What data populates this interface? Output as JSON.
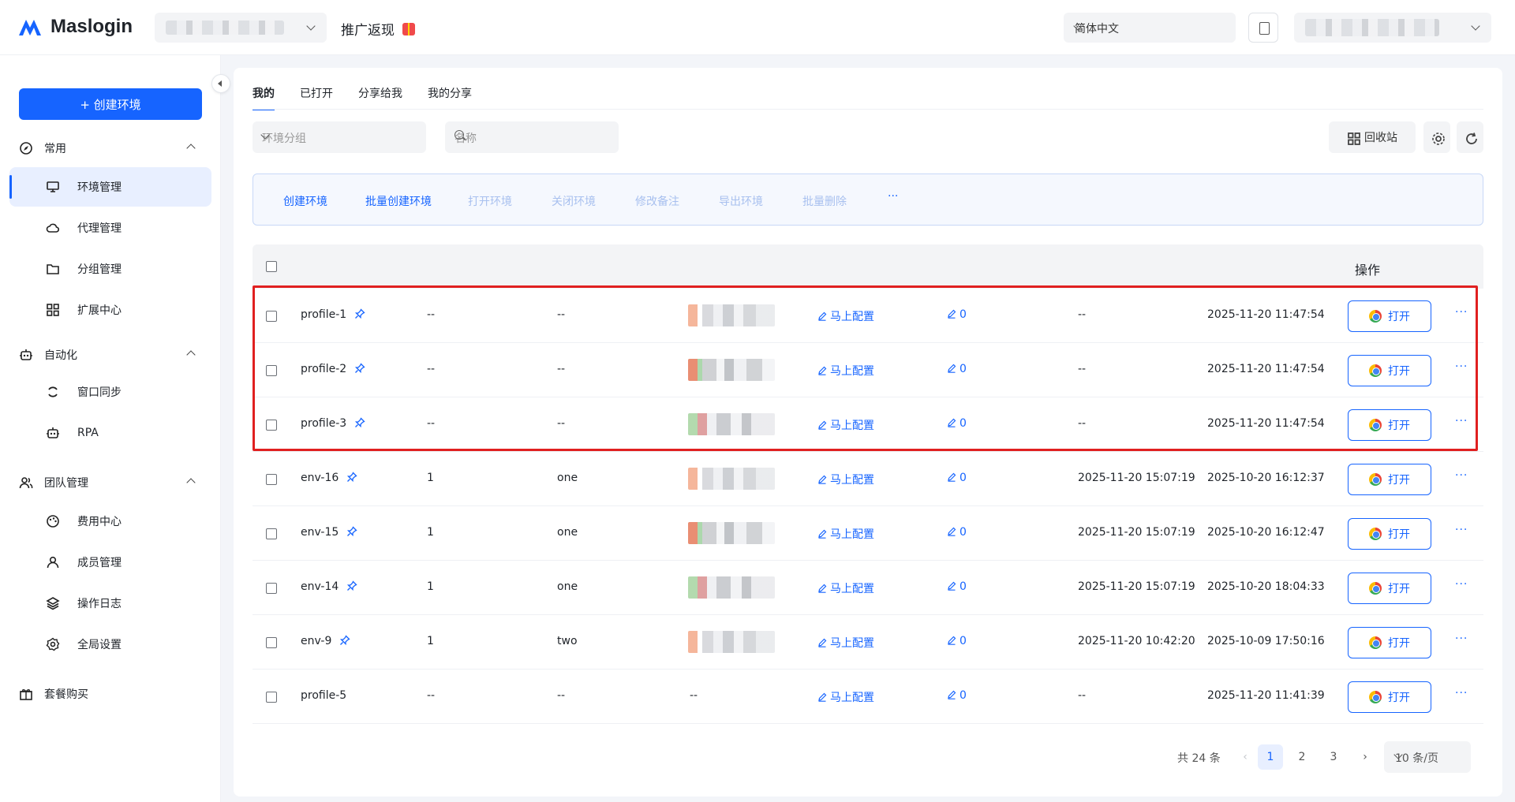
{
  "header": {
    "logo_text": "Maslogin",
    "promo_label": "推广返现",
    "language": "简体中文"
  },
  "sidebar": {
    "create_label": "+ 创建环境",
    "groups": [
      {
        "label": "常用",
        "items": [
          "环境管理",
          "代理管理",
          "分组管理",
          "扩展中心"
        ]
      },
      {
        "label": "自动化",
        "items": [
          "窗口同步",
          "RPA"
        ]
      },
      {
        "label": "团队管理",
        "items": [
          "费用中心",
          "成员管理",
          "操作日志",
          "全局设置"
        ]
      }
    ],
    "bottom_item": "套餐购买"
  },
  "main": {
    "tabs": [
      "我的",
      "已打开",
      "分享给我",
      "我的分享"
    ],
    "filters": {
      "group_placeholder": "环境分组",
      "name_placeholder": "名称"
    },
    "recycle_label": "回收站",
    "actions": [
      "创建环境",
      "批量创建环境",
      "打开环境",
      "关闭环境",
      "修改备注",
      "导出环境",
      "批量删除",
      "···"
    ],
    "table": {
      "header_action": "操作",
      "config_label": "马上配置",
      "open_label": "打开",
      "more_label": "···",
      "rows": [
        {
          "name": "profile-1",
          "pinned": true,
          "col2": "--",
          "col3": "--",
          "has_proxy_img": true,
          "count": "0",
          "opened": "--",
          "created": "2025-11-20 11:47:54"
        },
        {
          "name": "profile-2",
          "pinned": true,
          "col2": "--",
          "col3": "--",
          "has_proxy_img": true,
          "count": "0",
          "opened": "--",
          "created": "2025-11-20 11:47:54"
        },
        {
          "name": "profile-3",
          "pinned": true,
          "col2": "--",
          "col3": "--",
          "has_proxy_img": true,
          "count": "0",
          "opened": "--",
          "created": "2025-11-20 11:47:54"
        },
        {
          "name": "env-16",
          "pinned": true,
          "col2": "1",
          "col3": "one",
          "has_proxy_img": true,
          "count": "0",
          "opened": "2025-11-20 15:07:19",
          "created": "2025-10-20 16:12:37"
        },
        {
          "name": "env-15",
          "pinned": true,
          "col2": "1",
          "col3": "one",
          "has_proxy_img": true,
          "count": "0",
          "opened": "2025-11-20 15:07:19",
          "created": "2025-10-20 16:12:47"
        },
        {
          "name": "env-14",
          "pinned": true,
          "col2": "1",
          "col3": "one",
          "has_proxy_img": true,
          "count": "0",
          "opened": "2025-11-20 15:07:19",
          "created": "2025-10-20 18:04:33"
        },
        {
          "name": "env-9",
          "pinned": true,
          "col2": "1",
          "col3": "two",
          "has_proxy_img": true,
          "count": "0",
          "opened": "2025-11-20 10:42:20",
          "created": "2025-10-09 17:50:16"
        },
        {
          "name": "profile-5",
          "pinned": false,
          "col2": "--",
          "col3": "--",
          "has_proxy_img": false,
          "proxy_text": "--",
          "count": "0",
          "opened": "--",
          "created": "2025-11-20 11:41:39"
        }
      ]
    },
    "pagination": {
      "total": "共 24 条",
      "pages": [
        "1",
        "2",
        "3"
      ],
      "current": "1",
      "page_size": "10 条/页"
    }
  },
  "colors": {
    "accent": "#1664ff",
    "highlight": "#e02020"
  }
}
